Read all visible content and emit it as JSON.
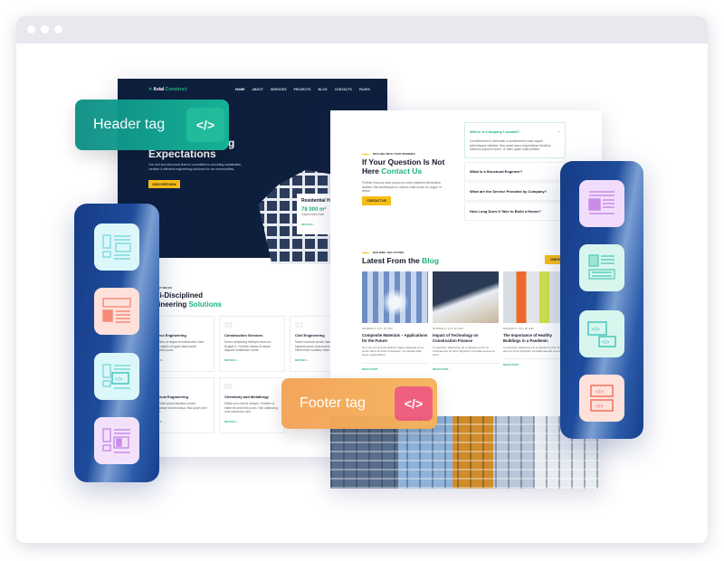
{
  "tags": {
    "header": "Header tag",
    "footer": "Footer tag",
    "code_icon": "</>"
  },
  "colors": {
    "accent_green": "#20b27a",
    "yellow": "#f7bd18",
    "dark_navy": "#0e1e3d",
    "header_tag": "#12a88f",
    "footer_tag": "#f5a04e"
  },
  "left_page": {
    "logo": {
      "a": "Axial",
      "b": "Construct"
    },
    "nav": [
      "HOME",
      "ABOUT",
      "SERVICES",
      "PROJECTS",
      "BLOG",
      "CONTACTS",
      "PAGES"
    ],
    "hero_title_end": "g",
    "hero_title": "Expectations",
    "hero_text": "Our civil and structural team is committed to providing sustainable, creative & efficient engineering solutions for our communities.",
    "hero_button": "DISCOVER NOW",
    "residential": {
      "title": "Residential H",
      "area": "78 000 m²",
      "label": "Carpet Area Size",
      "details": "DETAILS →"
    },
    "section_kicker": "WHAT WE DO",
    "section_title_a": "Multi-Disciplined",
    "section_title_b": "Engineering",
    "section_title_c": "Solutions",
    "services": [
      {
        "num": "01",
        "title": "Process Engineering",
        "text": "Vestibulum at neque et malesuada. Nam tempor sapien at ligula ullamcorper malesuada purus.",
        "details": "DETAILS →"
      },
      {
        "num": "02",
        "title": "Construction Services",
        "text": "Donec adipiscing tristique risus nec feugiat in. Porttitor massa id neque aliquam vestibulum morbi.",
        "details": "DETAILS →"
      },
      {
        "num": "03",
        "title": "Civil Engineering",
        "text": "Morbi tincidunt ornare massa eget egestas purus viverra accumsan in elementum curabitur vitae.",
        "details": "DETAILS →"
      },
      {
        "num": "04",
        "title": "Electrical Engineering",
        "text": "Auctor vitae purus faucibus ornare suspendisse sed nisi lacus. Nisl quam sem et tortor.",
        "details": "DETAILS →"
      },
      {
        "num": "05",
        "title": "Chemistry and Metallurgy",
        "text": "Mollis nunc sed id semper. Sodales ut etiam sit amet nisl purus. Sed adipiscing cras commodo odio.",
        "details": "DETAILS →"
      }
    ]
  },
  "right_page": {
    "kicker": "DEALING WITH YOUR WORRIES",
    "title_a": "If Your Question Is Not",
    "title_b": "Here",
    "title_c": "Contact Us",
    "text": "Porttitor rhoncus dolor purus non enim praesent elementum facilisis. Nisl scelerisque eu ultrices vitae auctor eu augue ut lectus.",
    "button": "CONTACT US",
    "faq": [
      {
        "q": "Where is Company Located?",
        "a": "Condimentum id venenatis a condimentum vitae sapien pellentesque habitant. Non quam lacus suspendisse faucibus interdum posuere lorem. Ut diam quam nulla porttitor.",
        "icon": "−"
      },
      {
        "q": "What is a Structural Engineer?"
      },
      {
        "q": "What are the Service Provided by Company?"
      },
      {
        "q": "How Long Does It Take to Build a House?"
      }
    ],
    "blog_kicker": "BUILDING THE FUTURE",
    "blog_title_a": "Latest From the",
    "blog_title_b": "Blog",
    "blog_button": "OUR BLOG",
    "posts": [
      {
        "category": "MATERIALS",
        "date": "JULY 18, 2022",
        "title": "Composite Materials – Applications for the Future",
        "text": "Non nisi est sit amet facilisis magna. Egestas lorem ipsum dolor sit amet consectetur. At egestas diam ipsum suspendisse.",
        "link": "READ POST →"
      },
      {
        "category": "MATERIALS",
        "date": "JULY 18, 2022",
        "title": "Impact of Technology on Construction Finance",
        "text": "Consectetur adipiscing elit ut aliquam purus sit. Gravida arcu ac tortor dignissim convallis aenean et tortor.",
        "link": "READ POST →"
      },
      {
        "category": "MATERIALS",
        "date": "JULY 18, 2022",
        "title": "The Importance of Healthy Buildings in a Pandemic",
        "text": "Consectetur adipiscing elit ut aliquam purus. Gravida arcu ac tortor dignissim convallis aenean et tortor.",
        "link": "READ POST →"
      }
    ]
  },
  "left_panel_icons": [
    "layout-sidebar-card-icon",
    "layout-header-image-icon",
    "layout-code-block-icon",
    "layout-media-icon"
  ],
  "right_panel_icons": [
    "layout-header-image-icon",
    "layout-sidebar-card-icon",
    "layout-code-window-icon",
    "layout-code-split-icon"
  ]
}
